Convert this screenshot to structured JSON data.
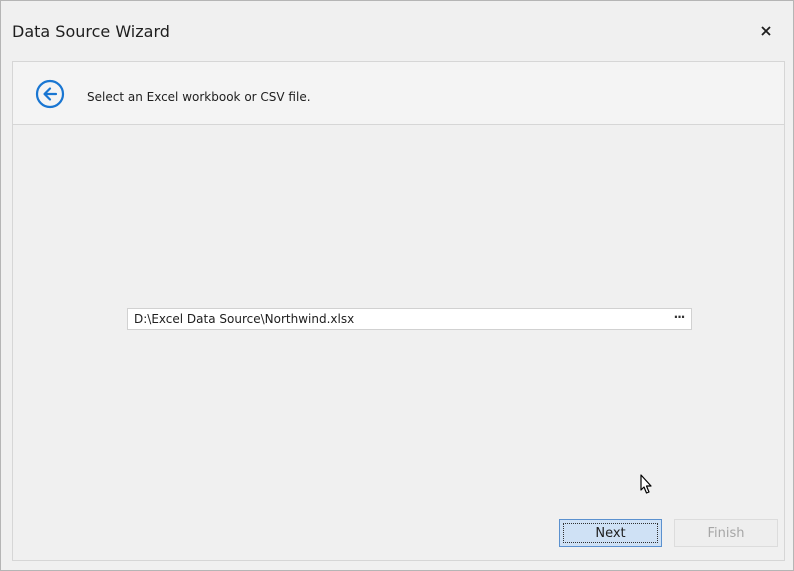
{
  "window": {
    "title": "Data Source Wizard",
    "close_glyph": "×"
  },
  "wizard": {
    "instruction": "Select an Excel workbook or CSV file.",
    "file_path": "D:\\Excel Data Source\\Northwind.xlsx",
    "browse_glyph": "···"
  },
  "buttons": {
    "next_label": "Next",
    "finish_label": "Finish"
  },
  "icons": {
    "back": "back-arrow-circle-icon",
    "close": "close-icon",
    "cursor": "mouse-pointer-icon"
  },
  "colors": {
    "accent": "#1976d2",
    "next_bg": "#cfe1f5",
    "next_border": "#5b91cf",
    "disabled_text": "#a6a6a6"
  }
}
